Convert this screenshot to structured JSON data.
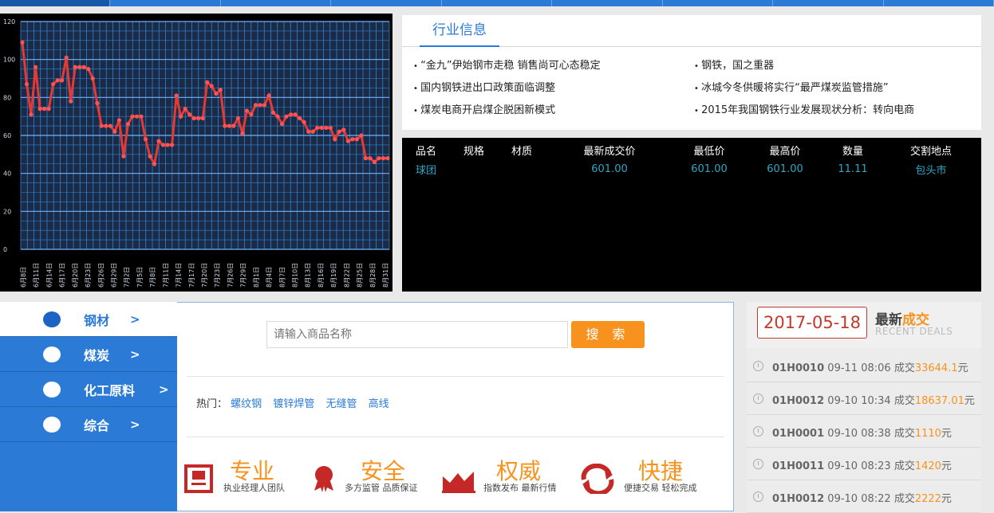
{
  "nav": {
    "tab_count": 9
  },
  "chart_data": {
    "type": "line",
    "ylim": [
      0,
      120
    ],
    "yticks": [
      "0",
      "20",
      "40",
      "60",
      "80",
      "100",
      "120"
    ],
    "x": [
      "6月8日",
      "6月11日",
      "6月14日",
      "6月17日",
      "6月20日",
      "6月23日",
      "6月26日",
      "6月29日",
      "7月2日",
      "7月5日",
      "7月8日",
      "7月11日",
      "7月14日",
      "7月17日",
      "7月20日",
      "7月23日",
      "7月26日",
      "7月29日",
      "8月1日",
      "8月4日",
      "8月7日",
      "8月10日",
      "8月13日",
      "8月16日",
      "8月19日",
      "8月22日",
      "8月25日",
      "8月28日",
      "8月31日"
    ],
    "values": [
      109,
      87,
      71,
      96,
      74,
      74,
      74,
      87,
      89,
      89,
      101,
      78,
      96,
      96,
      96,
      95,
      90,
      77,
      65,
      65,
      65,
      62,
      68,
      49,
      66,
      70,
      70,
      70,
      58,
      49,
      45,
      57,
      55,
      55,
      55,
      81,
      70,
      74,
      71,
      69,
      69,
      69,
      88,
      86,
      82,
      84,
      65,
      65,
      65,
      69,
      61,
      73,
      71,
      76,
      76,
      76,
      81,
      72,
      70,
      66,
      70,
      71,
      71,
      69,
      67,
      62,
      62,
      64,
      64,
      64,
      64,
      58,
      62,
      63,
      57,
      58,
      58,
      60,
      48,
      48,
      46,
      48,
      48,
      48
    ],
    "line_color": "#e53935",
    "point_color": "#ff5252",
    "grid_color": "#2e86d0"
  },
  "news": {
    "title": "行业信息",
    "items": [
      "“金九”伊始钢市走稳 销售尚可心态稳定",
      "钢铁，国之重器",
      "国内钢铁进出口政策面临调整",
      "冰城今冬供暖将实行“最严煤炭监管措施”",
      "煤炭电商开启煤企脱困新模式",
      "2015年我国钢铁行业发展现状分析：转向电商"
    ]
  },
  "deals_table": {
    "headers": [
      "品名",
      "规格",
      "材质",
      "最新成交价",
      "最低价",
      "最高价",
      "数量",
      "交割地点"
    ],
    "rows": [
      [
        "球团",
        "",
        "",
        "601.00",
        "601.00",
        "601.00",
        "11.11",
        "包头市"
      ]
    ]
  },
  "categories": [
    {
      "label": "钢材",
      "arrow": ">"
    },
    {
      "label": "煤炭",
      "arrow": ">"
    },
    {
      "label": "化工原料",
      "arrow": ">"
    },
    {
      "label": "综合",
      "arrow": ">"
    }
  ],
  "search": {
    "placeholder": "请输入商品名称",
    "button": "搜 索",
    "hot_label": "热门：",
    "hot_items": [
      "螺纹钢",
      "镀锌焊管",
      "无缝管",
      "高线"
    ]
  },
  "features": [
    {
      "title": "专业",
      "sub": "执业经理人团队",
      "icon": "certificate-icon",
      "color": "#c62828"
    },
    {
      "title": "安全",
      "sub": "多方监管  品质保证",
      "icon": "award-icon",
      "color": "#c62828"
    },
    {
      "title": "权威",
      "sub": "指数发布  最新行情",
      "icon": "chart-icon",
      "color": "#c62828"
    },
    {
      "title": "快捷",
      "sub": "便捷交易  轻松完成",
      "icon": "refresh-icon",
      "color": "#c62828"
    }
  ],
  "latest": {
    "date": "2017-05-18",
    "title_main": "最新",
    "title_accent": "成交",
    "subtitle": "RECENT DEALS",
    "rows": [
      {
        "code": "01H0010",
        "time": "09-11 08:06",
        "label": "成交",
        "amount": "33644.1",
        "unit": "元"
      },
      {
        "code": "01H0012",
        "time": "09-10 10:34",
        "label": "成交",
        "amount": "18637.01",
        "unit": "元"
      },
      {
        "code": "01H0001",
        "time": "09-10 08:38",
        "label": "成交",
        "amount": "1110",
        "unit": "元"
      },
      {
        "code": "01H0011",
        "time": "09-10 08:23",
        "label": "成交",
        "amount": "1420",
        "unit": "元"
      },
      {
        "code": "01H0012",
        "time": "09-10 08:22",
        "label": "成交",
        "amount": "2222",
        "unit": "元"
      }
    ]
  }
}
